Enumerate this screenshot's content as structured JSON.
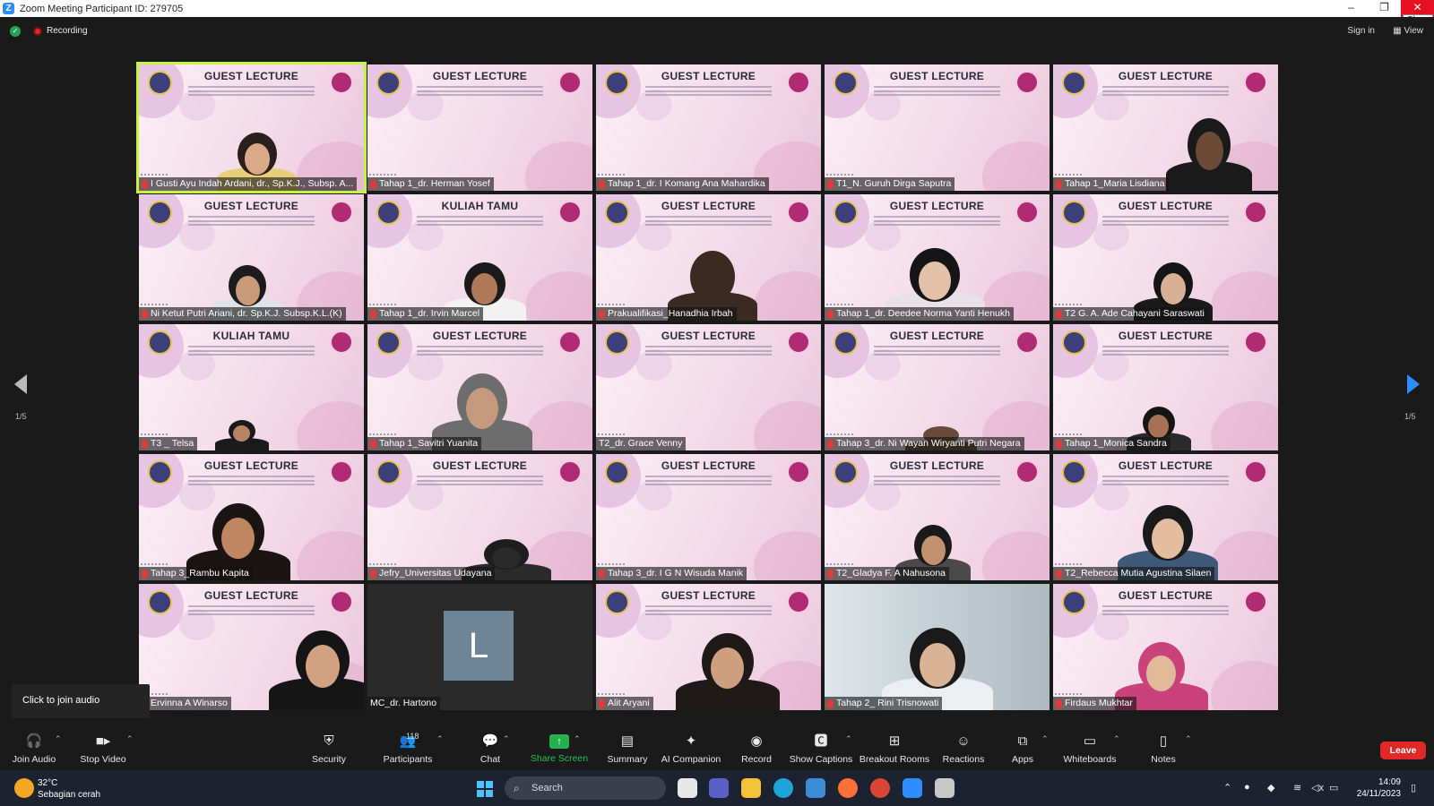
{
  "window": {
    "title": "Zoom Meeting Participant ID: 279705",
    "close_tooltip": "Close"
  },
  "meeting_bar": {
    "recording_label": "Recording",
    "sign_in": "Sign in",
    "view": "View"
  },
  "gallery": {
    "page_indicator_left": "1/5",
    "page_indicator_right": "1/5",
    "tiles": [
      {
        "name": "I Gusti Ayu Indah Ardani, dr., Sp.K.J., Subsp. A...",
        "slide": "GUEST LECTURE",
        "active": true
      },
      {
        "name": "Tahap 1_dr. Herman Yosef",
        "slide": "GUEST LECTURE"
      },
      {
        "name": "Tahap 1_dr. I Komang Ana Mahardika",
        "slide": "GUEST LECTURE"
      },
      {
        "name": "T1_N. Guruh Dirga Saputra",
        "slide": "GUEST LECTURE"
      },
      {
        "name": "Tahap 1_Maria Lisdiana",
        "slide": "GUEST LECTURE"
      },
      {
        "name": "Ni Ketut Putri Ariani, dr. Sp.K.J. Subsp.K.L.(K)",
        "slide": "GUEST LECTURE"
      },
      {
        "name": "Tahap 1_dr. Irvin Marcel",
        "slide": "KULIAH TAMU"
      },
      {
        "name": "Prakualifikasi_Hanadhia Irbah",
        "slide": "GUEST LECTURE"
      },
      {
        "name": "Tahap 1_dr. Deedee Norma Yanti Henukh",
        "slide": "GUEST LECTURE"
      },
      {
        "name": "T2 G. A. Ade Cahayani Saraswati",
        "slide": "GUEST LECTURE"
      },
      {
        "name": "T3 _ Telsa",
        "slide": "KULIAH TAMU"
      },
      {
        "name": "Tahap 1_Savitri Yuanita",
        "slide": "GUEST LECTURE"
      },
      {
        "name": "T2_dr. Grace Venny",
        "slide": "GUEST LECTURE"
      },
      {
        "name": "Tahap 3_dr. Ni Wayan Wiryanti Putri Negara",
        "slide": "GUEST LECTURE"
      },
      {
        "name": "Tahap 1_Monica Sandra",
        "slide": "GUEST LECTURE"
      },
      {
        "name": "Tahap 3_Rambu Kapita",
        "slide": "GUEST LECTURE"
      },
      {
        "name": "Jefry_Universitas Udayana",
        "slide": "GUEST LECTURE"
      },
      {
        "name": "Tahap 3_dr. I G N Wisuda Manik",
        "slide": "GUEST LECTURE"
      },
      {
        "name": "T2_Gladya F. A Nahusona",
        "slide": "GUEST LECTURE"
      },
      {
        "name": "T2_Rebecca Mutia Agustina Silaen",
        "slide": "GUEST LECTURE"
      },
      {
        "name": "Ervinna A Winarso",
        "slide": "GUEST LECTURE"
      },
      {
        "name": "MC_dr. Hartono",
        "avatar_letter": "L",
        "video_off": true
      },
      {
        "name": "Alit Aryani",
        "slide": "GUEST LECTURE"
      },
      {
        "name": "Tahap 2_ Rini Trisnowati",
        "slide": ""
      },
      {
        "name": "Firdaus Mukhtar",
        "slide": "GUEST LECTURE"
      }
    ]
  },
  "audio_tooltip": "Click to join audio",
  "toolbar": {
    "join_audio": "Join Audio",
    "stop_video": "Stop Video",
    "security": "Security",
    "participants": "Participants",
    "participants_count": "118",
    "chat": "Chat",
    "share_screen": "Share Screen",
    "summary": "Summary",
    "ai_companion": "AI Companion",
    "record": "Record",
    "show_captions": "Show Captions",
    "breakout_rooms": "Breakout Rooms",
    "reactions": "Reactions",
    "apps": "Apps",
    "whiteboards": "Whiteboards",
    "notes": "Notes",
    "leave": "Leave"
  },
  "taskbar": {
    "weather_temp": "32°C",
    "weather_desc": "Sebagian cerah",
    "search_placeholder": "Search",
    "time": "14:09",
    "date": "24/11/2023"
  },
  "colors": {
    "accent": "#2d8cff",
    "active_speaker": "#c7f245",
    "leave": "#e02828",
    "share": "#23b14d"
  }
}
